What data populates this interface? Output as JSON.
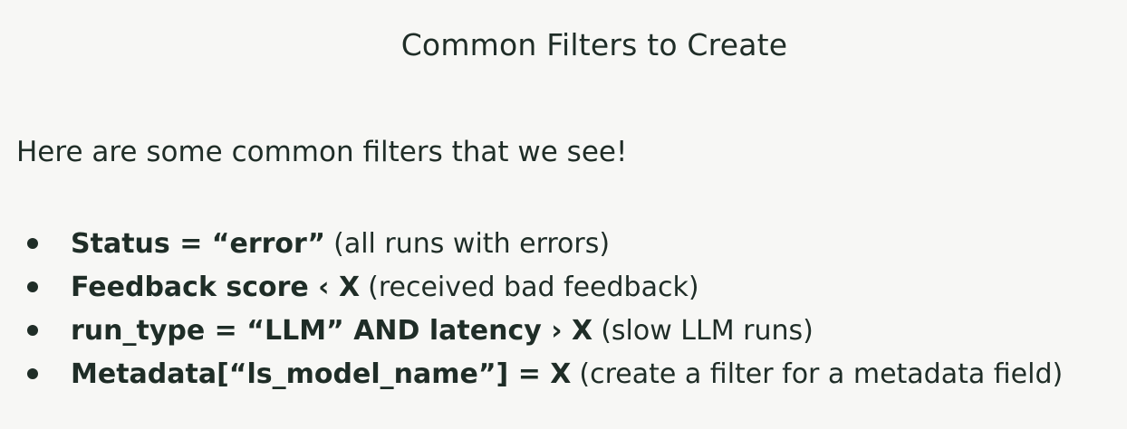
{
  "slide": {
    "title": "Common Filters to Create",
    "intro": "Here are some common filters that we see!",
    "bullets": [
      {
        "bold": "Status = “error”",
        "note": "(all runs with errors)"
      },
      {
        "bold": "Feedback score ‹ X",
        "note": "(received bad feedback)"
      },
      {
        "bold": "run_type = “LLM” AND latency › X",
        "note": "(slow LLM runs)"
      },
      {
        "bold": "Metadata[“ls_model_name”] = X",
        "note": "(create a filter for a metadata field)"
      }
    ]
  }
}
